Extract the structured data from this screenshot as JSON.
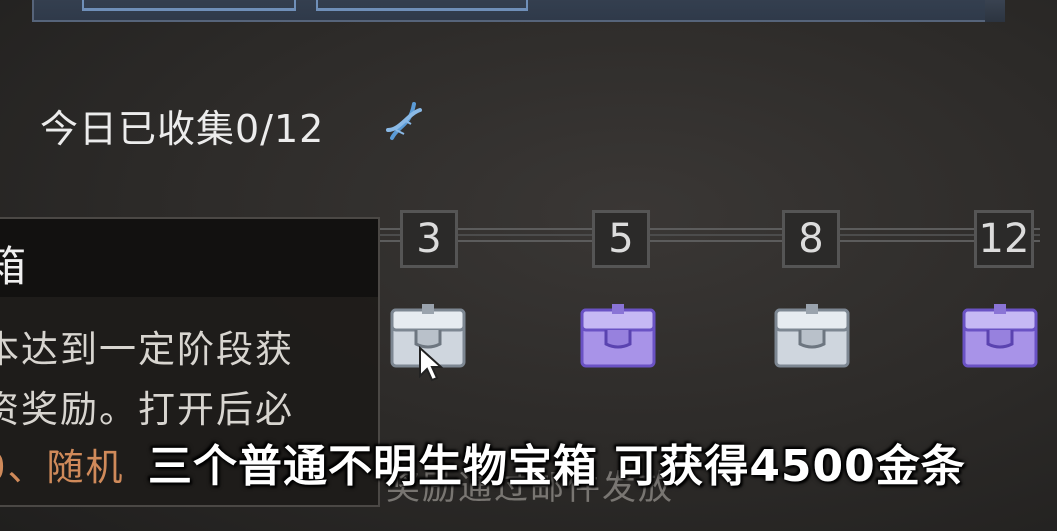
{
  "collect": {
    "label": "今日已收集0/12"
  },
  "progress": {
    "collected": 0,
    "total": 12,
    "milestones": [
      {
        "label": "3",
        "chest": "silver-chest-icon"
      },
      {
        "label": "5",
        "chest": "purple-chest-icon"
      },
      {
        "label": "8",
        "chest": "silver-chest-icon"
      },
      {
        "label": "12",
        "chest": "purple-chest-icon"
      }
    ]
  },
  "tooltip": {
    "title": "箱",
    "line1": "本达到一定阶段获",
    "line2": "资奖励。打开后必",
    "line3": "0、随机"
  },
  "background_text": "奖励通过邮件发放",
  "subtitle": "三个普通不明生物宝箱 可获得4500金条",
  "colors": {
    "silver_chest": "#cfd6de",
    "purple_chest": "#a893e8",
    "accent_orange": "#d08a5a",
    "dna_blue": "#5b9bd6"
  }
}
